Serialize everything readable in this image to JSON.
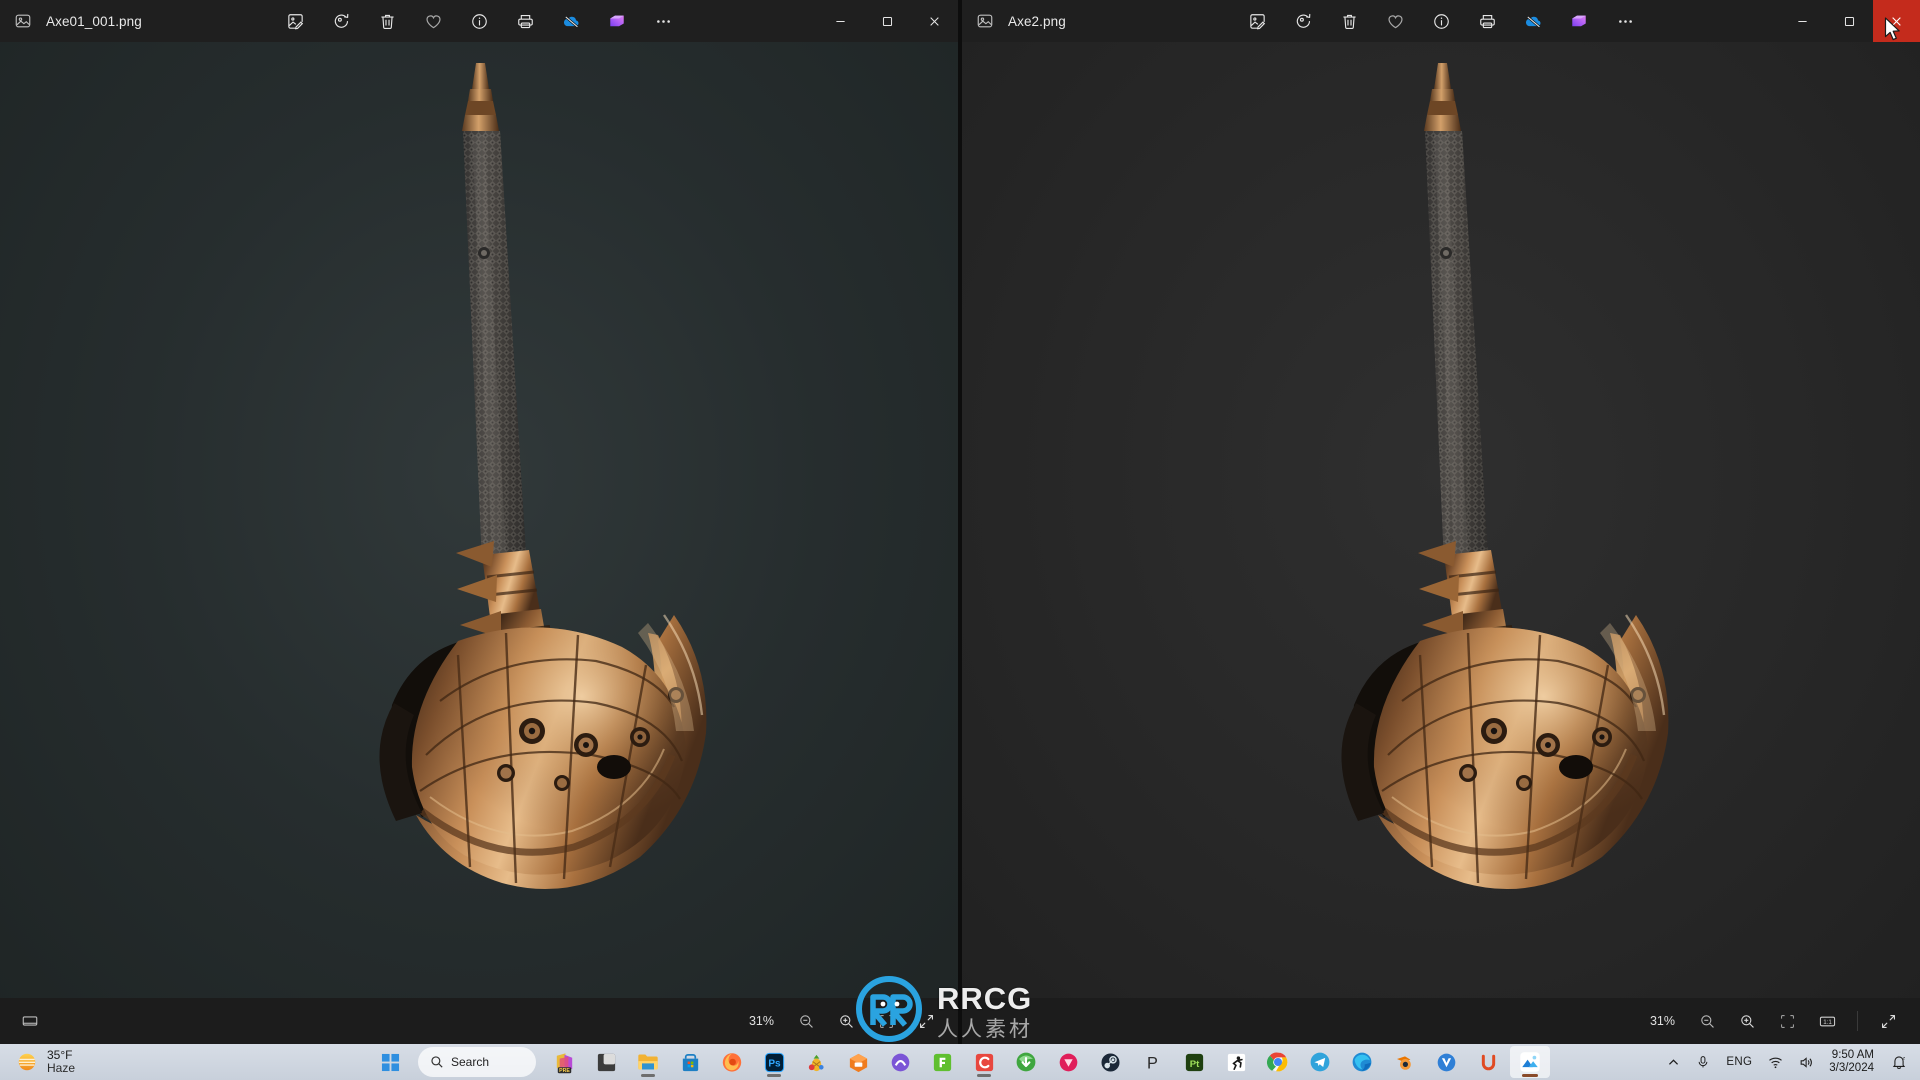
{
  "windows": [
    {
      "id": "left",
      "filename": "Axe01_001.png",
      "app_icon": "photos-app-icon",
      "toolbar": [
        {
          "name": "edit-image-icon",
          "label": "Edit image"
        },
        {
          "name": "rotate-icon",
          "label": "Rotate"
        },
        {
          "name": "delete-icon",
          "label": "Delete"
        },
        {
          "name": "favorite-heart-icon",
          "label": "Add to favorites"
        },
        {
          "name": "info-icon",
          "label": "File info"
        },
        {
          "name": "print-icon",
          "label": "Print"
        },
        {
          "name": "onedrive-off-icon",
          "label": "OneDrive sync off"
        },
        {
          "name": "designer-icon",
          "label": "Designer"
        },
        {
          "name": "more-options-icon",
          "label": "See more"
        }
      ],
      "window_controls": [
        {
          "name": "minimize-button",
          "glyph": "minimize"
        },
        {
          "name": "maximize-button",
          "glyph": "maximize"
        },
        {
          "name": "close-button",
          "glyph": "close"
        }
      ],
      "status": {
        "zoom_level": "31%",
        "buttons": [
          {
            "name": "zoom-out-button",
            "label": "Zoom out"
          },
          {
            "name": "zoom-in-button",
            "label": "Zoom in"
          },
          {
            "name": "fit-to-window-button",
            "label": "Fit to window"
          },
          {
            "name": "fullscreen-button",
            "label": "Full screen"
          }
        ],
        "left_button": {
          "name": "filmstrip-button",
          "label": "Filmstrip"
        }
      }
    },
    {
      "id": "right",
      "filename": "Axe2.png",
      "app_icon": "photos-app-icon",
      "toolbar": [
        {
          "name": "edit-image-icon",
          "label": "Edit image"
        },
        {
          "name": "rotate-icon",
          "label": "Rotate"
        },
        {
          "name": "delete-icon",
          "label": "Delete"
        },
        {
          "name": "favorite-heart-icon",
          "label": "Add to favorites"
        },
        {
          "name": "info-icon",
          "label": "File info"
        },
        {
          "name": "print-icon",
          "label": "Print"
        },
        {
          "name": "onedrive-off-icon",
          "label": "OneDrive sync off"
        },
        {
          "name": "designer-icon",
          "label": "Designer"
        },
        {
          "name": "more-options-icon",
          "label": "See more"
        }
      ],
      "window_controls": [
        {
          "name": "minimize-button",
          "glyph": "minimize"
        },
        {
          "name": "maximize-button",
          "glyph": "maximize"
        },
        {
          "name": "close-button",
          "glyph": "close"
        }
      ],
      "status": {
        "zoom_level": "31%",
        "buttons": [
          {
            "name": "zoom-out-button",
            "label": "Zoom out"
          },
          {
            "name": "zoom-in-button",
            "label": "Zoom in"
          },
          {
            "name": "fit-to-window-button",
            "label": "Fit to window"
          },
          {
            "name": "actual-size-button",
            "label": "1:1"
          },
          {
            "name": "fullscreen-button",
            "label": "Full screen"
          }
        ]
      }
    }
  ],
  "watermark": {
    "text": "RRCG",
    "subtext": "人人素材"
  },
  "taskbar": {
    "weather": {
      "temperature": "35°F",
      "condition": "Haze",
      "icon": "haze-sun-icon"
    },
    "start": {
      "name": "start-button",
      "label": "Start"
    },
    "search": {
      "placeholder": "Search",
      "label": "Search"
    },
    "apps": [
      {
        "name": "taskbar-copilot-pre",
        "label": "Copilot PRE",
        "running": false
      },
      {
        "name": "taskbar-app-dark",
        "label": "App",
        "running": false
      },
      {
        "name": "taskbar-file-explorer",
        "label": "File Explorer",
        "running": true
      },
      {
        "name": "taskbar-microsoft-store",
        "label": "Microsoft Store",
        "running": false
      },
      {
        "name": "taskbar-firefox",
        "label": "Firefox",
        "running": false
      },
      {
        "name": "taskbar-photoshop",
        "label": "Adobe Photoshop",
        "running": true
      },
      {
        "name": "taskbar-pineapple",
        "label": "Media App",
        "running": false
      },
      {
        "name": "taskbar-orange-box",
        "label": "Orange Box App",
        "running": false
      },
      {
        "name": "taskbar-purple-circle",
        "label": "Purple App",
        "running": false
      },
      {
        "name": "taskbar-green-app",
        "label": "WPS Green",
        "running": false
      },
      {
        "name": "taskbar-red-app",
        "label": "WPS Red",
        "running": true
      },
      {
        "name": "taskbar-idm",
        "label": "Internet Download Manager",
        "running": false
      },
      {
        "name": "taskbar-pink-app",
        "label": "Pink App",
        "running": false
      },
      {
        "name": "taskbar-steam",
        "label": "Steam",
        "running": false
      },
      {
        "name": "taskbar-p-app",
        "label": "P App",
        "running": false
      },
      {
        "name": "taskbar-pt-app",
        "label": "Pt App",
        "running": false
      },
      {
        "name": "taskbar-runner-app",
        "label": "Runner App",
        "running": false
      },
      {
        "name": "taskbar-chrome",
        "label": "Google Chrome",
        "running": false
      },
      {
        "name": "taskbar-telegram",
        "label": "Telegram",
        "running": false
      },
      {
        "name": "taskbar-edge",
        "label": "Microsoft Edge",
        "running": false
      },
      {
        "name": "taskbar-blender",
        "label": "Blender",
        "running": false
      },
      {
        "name": "taskbar-v-app",
        "label": "V App",
        "running": false
      },
      {
        "name": "taskbar-u-app",
        "label": "U App",
        "running": false
      },
      {
        "name": "taskbar-photos",
        "label": "Photos",
        "running": true,
        "active": true
      }
    ],
    "tray": {
      "overflow": {
        "name": "show-hidden-icons",
        "label": "Show hidden icons"
      },
      "microphone": {
        "name": "microphone-icon",
        "label": "Microphone"
      },
      "language": "ENG",
      "wifi": {
        "name": "wifi-icon",
        "label": "Network"
      },
      "volume": {
        "name": "volume-icon",
        "label": "Volume"
      },
      "clock": {
        "time": "9:50 AM",
        "date": "3/3/2024"
      },
      "notifications": {
        "name": "notification-bell-icon",
        "label": "Notifications"
      }
    }
  },
  "colors": {
    "window_bg": "#1c1c1c",
    "titlebar_bg": "#1f1f1f",
    "canvas_left": "#2b3233",
    "canvas_right": "#2a2a2a",
    "close_hover": "#c42b1c",
    "taskbar_bg": "#d0d7e1",
    "accent": "#0078d4"
  }
}
